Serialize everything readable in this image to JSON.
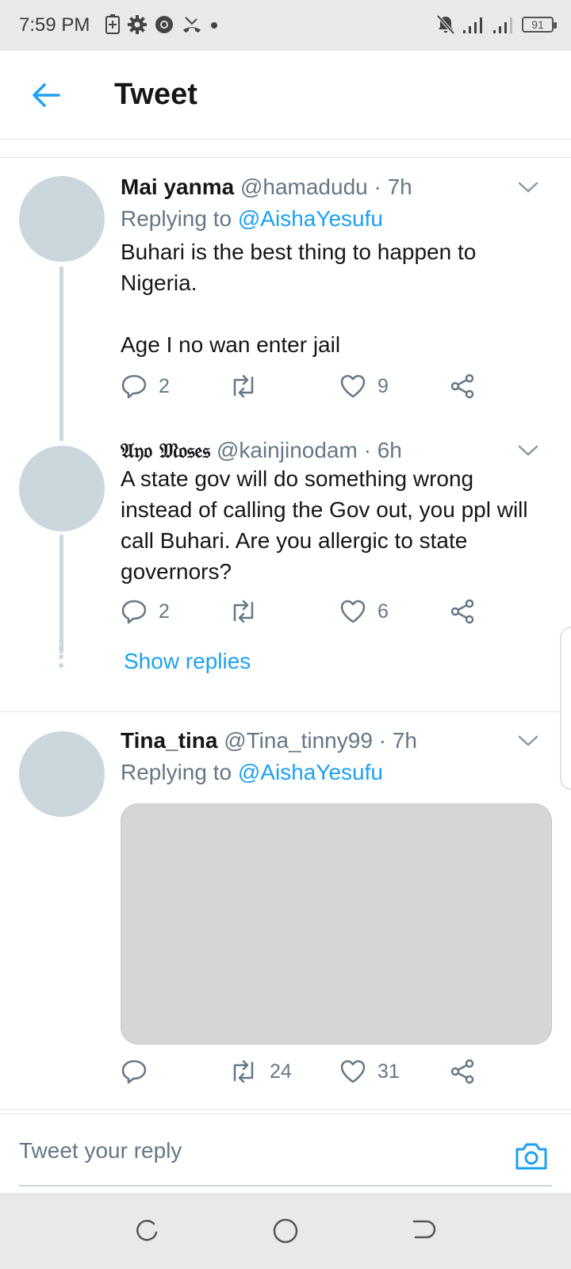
{
  "status_bar": {
    "time": "7:59 PM",
    "battery": "91",
    "icons_left": [
      "battery-saver-icon",
      "gear-icon",
      "chrome-icon",
      "missed-call-icon",
      "dot-icon"
    ],
    "icons_right": [
      "mute-icon",
      "signal-icon",
      "signal-icon",
      "battery-icon"
    ]
  },
  "header": {
    "title": "Tweet",
    "back_icon": "arrow-left-icon",
    "accent": "#1da1f2"
  },
  "tweets": [
    {
      "name": "Mai yanma",
      "handle": "@hamadudu",
      "sep": " · ",
      "time": "7h",
      "replying_prefix": "Replying to ",
      "replying_to": "@AishaYesufu",
      "text": "Buhari is the best thing to happen to Nigeria.\n\nAge I no wan enter jail",
      "replies": "2",
      "retweets": "",
      "likes": "9"
    },
    {
      "name": "𝔄𝔶𝔬 𝔐𝔬𝔰𝔢𝔰",
      "handle": "@kainjinodam",
      "sep": " · ",
      "time": "6h",
      "text": "A state gov will do something wrong instead of calling the Gov out, you ppl will call Buhari. Are you allergic to state governors?",
      "replies": "2",
      "retweets": "",
      "likes": "6"
    },
    {
      "name": "Tina_tina",
      "handle": "@Tina_tinny99",
      "sep": " · ",
      "time": "7h",
      "replying_prefix": "Replying to ",
      "replying_to": "@AishaYesufu",
      "replies": "",
      "retweets": "24",
      "likes": "31"
    }
  ],
  "show_replies": "Show replies",
  "composer": {
    "placeholder": "Tweet your reply",
    "camera_icon": "camera-icon"
  },
  "nav": [
    "recents-icon",
    "home-icon",
    "back-icon"
  ]
}
